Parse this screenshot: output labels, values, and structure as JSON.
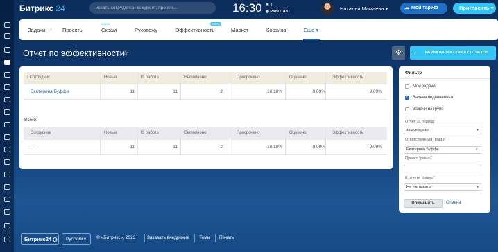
{
  "header": {
    "logo_name": "Битрикс",
    "logo_num": "24",
    "search_placeholder": "искать сотрудника, документ, прочее...",
    "clock": "16:30",
    "flag_count": "1",
    "work_status": "РАБОТАЮ",
    "user_name": "Наталья Мамаева",
    "tariff_label": "Мой тариф",
    "invite_label": "Пригласить"
  },
  "tabs": [
    {
      "label": "Задачи"
    },
    {
      "label": "Проекты"
    },
    {
      "label": "Скрам",
      "badge": "новое"
    },
    {
      "label": "Руковожу"
    },
    {
      "label": "Эффективность",
      "badge": "100%"
    },
    {
      "label": "Маркет"
    },
    {
      "label": "Корзина"
    },
    {
      "label": "Еще"
    }
  ],
  "page": {
    "title": "Отчет по эффективности",
    "back_label": "ВЕРНУТЬСЯ К СПИСКУ ОТЧЕТОВ"
  },
  "table": {
    "headers": [
      "↑ Сотрудник",
      "Новые",
      "В работе",
      "Выполнено",
      "Просрочено",
      "Оценено",
      "Эффективность"
    ],
    "row": [
      "Екатерина Буффе",
      "11",
      "11",
      "2",
      "18.18%",
      "9.09%",
      "9.09%"
    ],
    "total_label": "Всего:",
    "total_headers": [
      "Сотрудник",
      "Новые",
      "В работе",
      "Выполнено",
      "Просрочено",
      "Оценено",
      "Эффективность"
    ],
    "total_row": [
      "—",
      "11",
      "11",
      "2",
      "18.18%",
      "9.09%",
      "9.09%"
    ]
  },
  "filter": {
    "title": "Фильтр",
    "checkboxes": [
      {
        "label": "Мои задачи",
        "checked": false
      },
      {
        "label": "Задачи подчиненных",
        "checked": true
      },
      {
        "label": "Задачи из групп",
        "checked": false
      }
    ],
    "period_label": "Отчет за период",
    "period_value": "за все время",
    "responsible_label": "Ответственный \"равно\"",
    "responsible_value": "Екатерина Буффе",
    "project_label": "Проект \"равно\"",
    "project_value": "",
    "report_label": "В отчете \"равно\"",
    "report_value": "Не учитывать",
    "apply_label": "Применить",
    "cancel_label": "Отмена"
  },
  "footer": {
    "logo": "Битрикс24",
    "language": "Русский",
    "copyright": "© «Битрикс», 2023",
    "order_link": "Заказать внедрение",
    "themes_link": "Темы",
    "print_link": "Печать"
  }
}
